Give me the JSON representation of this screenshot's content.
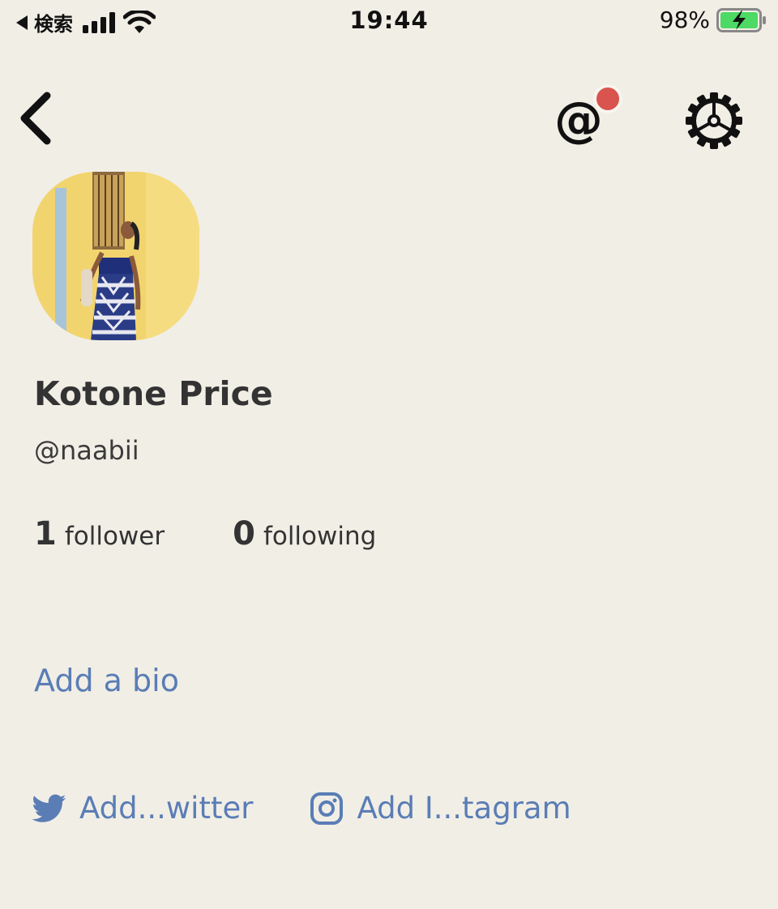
{
  "status_bar": {
    "back_app": "検索",
    "time": "19:44",
    "battery": "98%"
  },
  "nav": {
    "back_icon": "chevron-left-icon",
    "mention_icon": "at-icon",
    "mention_symbol": "@",
    "settings_icon": "gear-icon"
  },
  "profile": {
    "name": "Kotone Price",
    "handle": "@naabii",
    "followers_count": "1",
    "followers_label": "follower",
    "following_count": "0",
    "following_label": "following",
    "add_bio": "Add a bio"
  },
  "social": {
    "twitter_label": "Add...witter",
    "instagram_label": "Add I...tagram"
  },
  "colors": {
    "background": "#f1eee6",
    "link": "#5a7db5",
    "notification": "#d9534f",
    "battery_fill": "#4cd964"
  }
}
